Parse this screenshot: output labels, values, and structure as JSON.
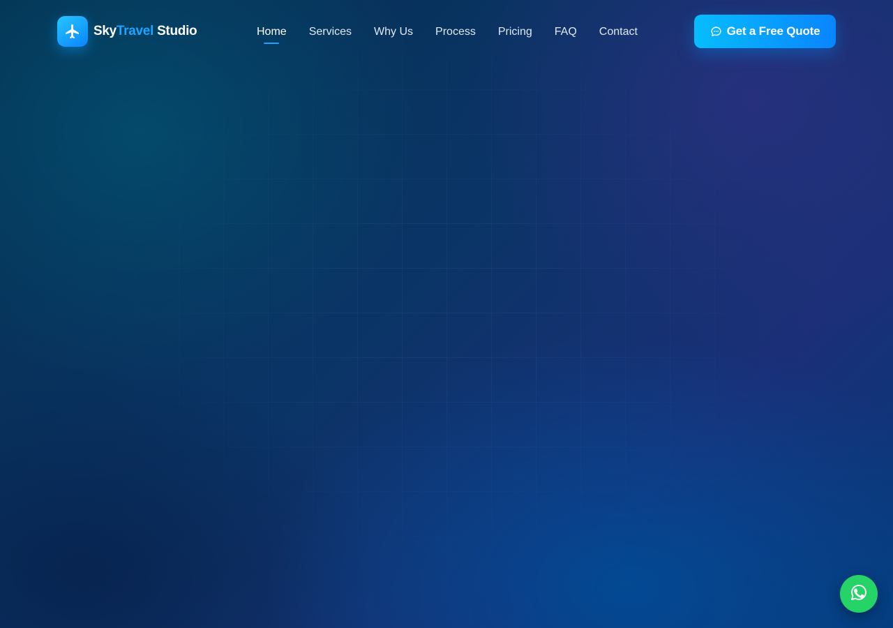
{
  "brand": {
    "logo_icon": "plane-icon",
    "name_part1": "Sky",
    "name_part2": "Travel",
    "name_part3": "Studio",
    "accent_color": "#1ea3ff"
  },
  "nav": {
    "items": [
      {
        "label": "Home",
        "active": true
      },
      {
        "label": "Services",
        "active": false
      },
      {
        "label": "Why Us",
        "active": false
      },
      {
        "label": "Process",
        "active": false
      },
      {
        "label": "Pricing",
        "active": false
      },
      {
        "label": "FAQ",
        "active": false
      },
      {
        "label": "Contact",
        "active": false
      }
    ]
  },
  "cta": {
    "icon": "chat-bubble-icon",
    "label": "Get a Free Quote",
    "gradient_start": "#06bdfc",
    "gradient_end": "#0a84ff"
  },
  "floating": {
    "icon": "whatsapp-icon",
    "color": "#25d366"
  }
}
